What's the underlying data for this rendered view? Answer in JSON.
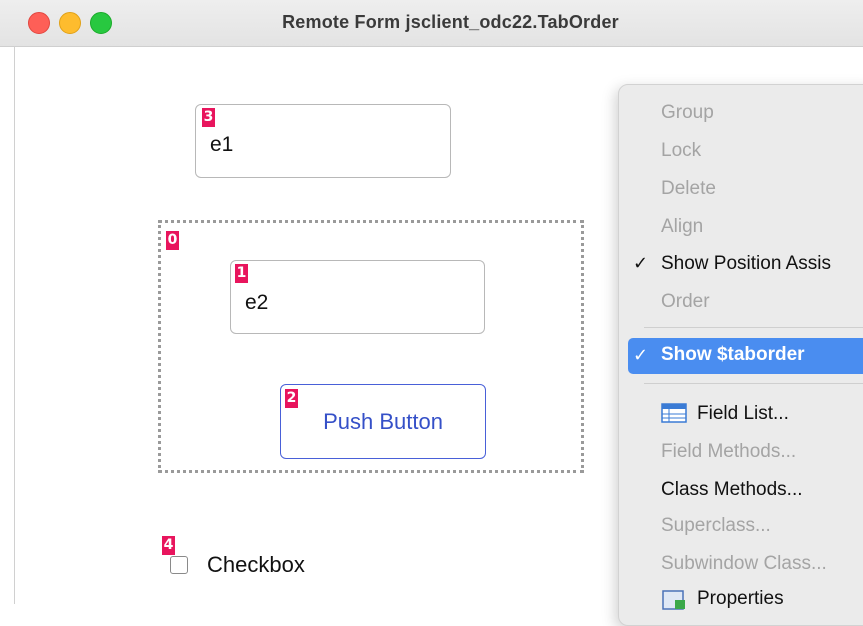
{
  "window": {
    "title": "Remote Form jsclient_odc22.TabOrder"
  },
  "form": {
    "field1": {
      "value": "e1",
      "taborder": "3"
    },
    "container": {
      "taborder": "0"
    },
    "field2": {
      "value": "e2",
      "taborder": "1"
    },
    "button": {
      "label": "Push Button",
      "taborder": "2"
    },
    "checkbox": {
      "label": "Checkbox",
      "taborder": "4",
      "checked": false
    }
  },
  "context_menu": {
    "items": [
      {
        "label": "Group",
        "enabled": false
      },
      {
        "label": "Lock",
        "enabled": false
      },
      {
        "label": "Delete",
        "enabled": false
      },
      {
        "label": "Align",
        "enabled": false
      },
      {
        "label": "Show Position Assis",
        "enabled": true,
        "checked": true
      },
      {
        "label": "Order",
        "enabled": false
      },
      {
        "label": "Show $taborder",
        "enabled": true,
        "checked": true,
        "highlighted": true
      },
      {
        "label": "Field List...",
        "enabled": true,
        "icon": "field-list-icon"
      },
      {
        "label": "Field Methods...",
        "enabled": false
      },
      {
        "label": "Class Methods...",
        "enabled": true
      },
      {
        "label": "Superclass...",
        "enabled": false
      },
      {
        "label": "Subwindow Class...",
        "enabled": false
      },
      {
        "label": "Properties",
        "enabled": true,
        "icon": "properties-icon"
      }
    ],
    "check_glyph": "✓"
  },
  "colors": {
    "badge": "#e8155d",
    "highlight": "#4a8df0",
    "button_text": "#3550c8"
  }
}
